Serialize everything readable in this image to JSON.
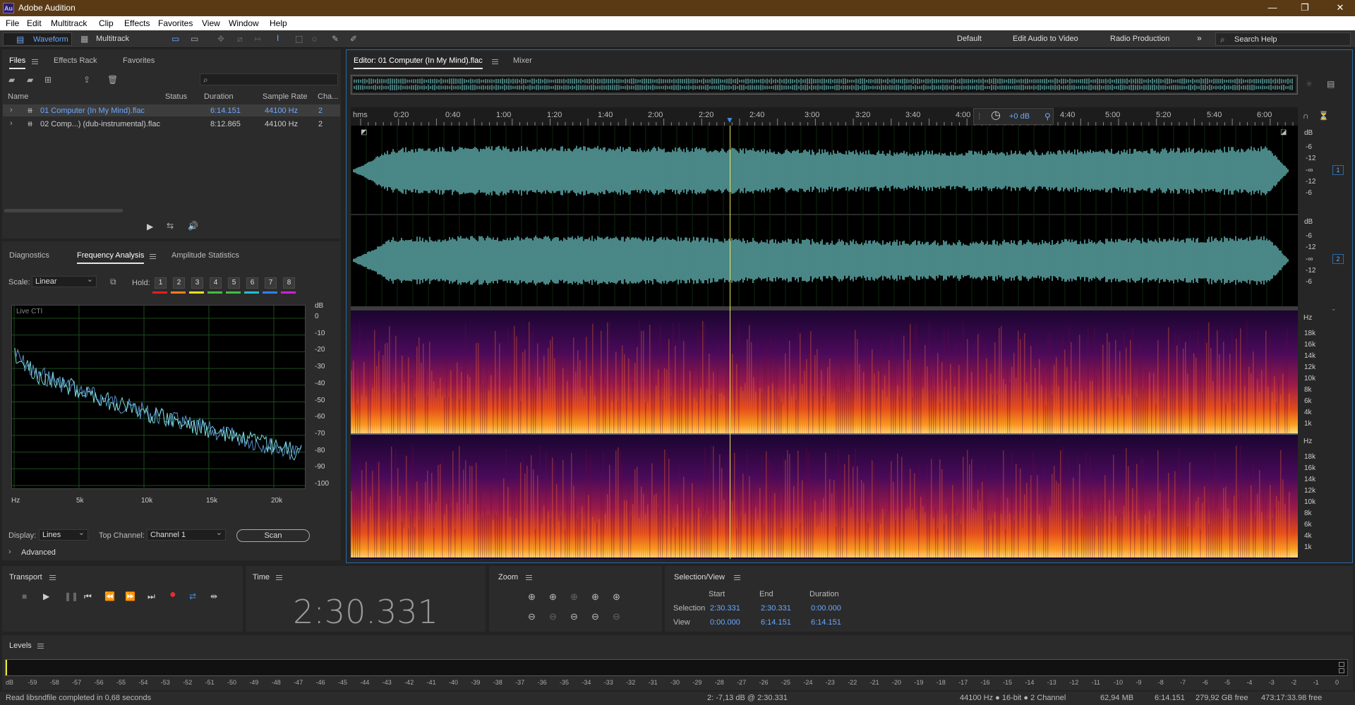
{
  "app": {
    "title": "Adobe Audition",
    "logo": "Au"
  },
  "menu": [
    "File",
    "Edit",
    "Multitrack",
    "Clip",
    "Effects",
    "Favorites",
    "View",
    "Window",
    "Help"
  ],
  "toolbar": {
    "waveform": "Waveform",
    "multitrack": "Multitrack",
    "workspaces": [
      "Default",
      "Edit Audio to Video",
      "Radio Production"
    ],
    "search_placeholder": "Search Help"
  },
  "files_panel": {
    "tabs": [
      "Files",
      "Effects Rack",
      "Favorites"
    ],
    "columns": [
      "Name",
      "Status",
      "Duration",
      "Sample Rate",
      "Cha..."
    ],
    "rows": [
      {
        "name": "01 Computer (In My Mind).flac",
        "status": "",
        "duration": "6:14.151",
        "rate": "44100 Hz",
        "ch": "2"
      },
      {
        "name": "02 Comp...) (dub-instrumental).flac",
        "status": "",
        "duration": "8:12.865",
        "rate": "44100 Hz",
        "ch": "2"
      }
    ]
  },
  "analysis_panel": {
    "tabs": [
      "Diagnostics",
      "Frequency Analysis",
      "Amplitude Statistics"
    ],
    "scale_label": "Scale:",
    "scale_value": "Linear",
    "hold_label": "Hold:",
    "hold": [
      "1",
      "2",
      "3",
      "4",
      "5",
      "6",
      "7",
      "8"
    ],
    "hold_colors": [
      "#e02020",
      "#f08020",
      "#e8e020",
      "#40c040",
      "#40c040",
      "#20c0d0",
      "#3080f0",
      "#d020d0"
    ],
    "graph_title": "Live CTI",
    "y_unit": "dB",
    "y_ticks": [
      "0",
      "-10",
      "-20",
      "-30",
      "-40",
      "-50",
      "-60",
      "-70",
      "-80",
      "-90",
      "-100"
    ],
    "x_ticks": [
      "Hz",
      "5k",
      "10k",
      "15k",
      "20k"
    ],
    "display_label": "Display:",
    "display_value": "Lines",
    "top_channel_label": "Top Channel:",
    "top_channel_value": "Channel 1",
    "scan": "Scan",
    "advanced": "Advanced"
  },
  "editor": {
    "tabs": [
      "Editor: 01 Computer (In My Mind).flac",
      "Mixer"
    ],
    "timeline": [
      "hms",
      "0:20",
      "0:40",
      "1:00",
      "1:20",
      "1:40",
      "2:00",
      "2:20",
      "2:40",
      "3:00",
      "3:20",
      "3:40",
      "4:00",
      "4:40",
      "5:00",
      "5:20",
      "5:40",
      "6:00"
    ],
    "volume": "+0 dB",
    "wave_ruler": {
      "unit": "dB",
      "ticks": [
        "-6",
        "-12",
        "-∞",
        "-12",
        "-6"
      ]
    },
    "channels": [
      "1",
      "2"
    ],
    "spec_ruler": {
      "unit": "Hz",
      "ticks": [
        "18k",
        "16k",
        "14k",
        "12k",
        "10k",
        "8k",
        "6k",
        "4k",
        "1k"
      ]
    },
    "wave_color": "#7be0e0"
  },
  "transport": {
    "title": "Transport"
  },
  "time": {
    "title": "Time",
    "value": "2:30.331"
  },
  "zoom": {
    "title": "Zoom"
  },
  "selection": {
    "title": "Selection/View",
    "headers": [
      "Start",
      "End",
      "Duration"
    ],
    "rows": [
      {
        "label": "Selection",
        "start": "2:30.331",
        "end": "2:30.331",
        "dur": "0:00.000"
      },
      {
        "label": "View",
        "start": "0:00.000",
        "end": "6:14.151",
        "dur": "6:14.151"
      }
    ]
  },
  "levels": {
    "title": "Levels",
    "scale": [
      "dB",
      "-59",
      "-58",
      "-57",
      "-56",
      "-55",
      "-54",
      "-53",
      "-52",
      "-51",
      "-50",
      "-49",
      "-48",
      "-47",
      "-46",
      "-45",
      "-44",
      "-43",
      "-42",
      "-41",
      "-40",
      "-39",
      "-38",
      "-37",
      "-36",
      "-35",
      "-34",
      "-33",
      "-32",
      "-31",
      "-30",
      "-29",
      "-28",
      "-27",
      "-26",
      "-25",
      "-24",
      "-23",
      "-22",
      "-21",
      "-20",
      "-19",
      "-18",
      "-17",
      "-16",
      "-15",
      "-14",
      "-13",
      "-12",
      "-11",
      "-10",
      "-9",
      "-8",
      "-7",
      "-6",
      "-5",
      "-4",
      "-3",
      "-2",
      "-1",
      "0"
    ]
  },
  "status": {
    "left": "Read libsndfile completed in 0,68 seconds",
    "cursor": "2: -7,13 dB @ 2:30.331",
    "format": "44100 Hz ● 16-bit ● 2 Channel",
    "size": "62,94 MB",
    "duration": "6:14.151",
    "free": "279,92 GB free",
    "time_free": "473:17:33.98 free"
  }
}
